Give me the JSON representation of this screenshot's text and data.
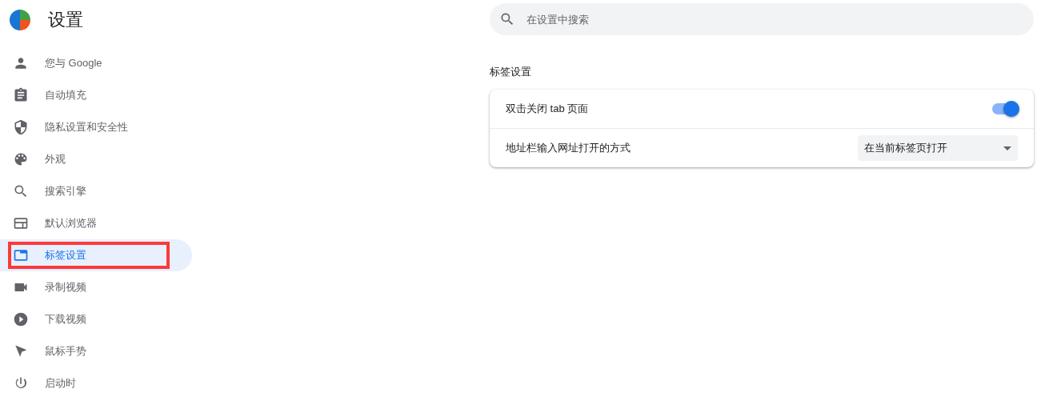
{
  "header": {
    "title": "设置"
  },
  "sidebar": {
    "items": [
      {
        "label": "您与 Google",
        "selected": false
      },
      {
        "label": "自动填充",
        "selected": false
      },
      {
        "label": "隐私设置和安全性",
        "selected": false
      },
      {
        "label": "外观",
        "selected": false
      },
      {
        "label": "搜索引擎",
        "selected": false
      },
      {
        "label": "默认浏览器",
        "selected": false
      },
      {
        "label": "标签设置",
        "selected": true,
        "annotated": true
      },
      {
        "label": "录制视频",
        "selected": false
      },
      {
        "label": "下载视频",
        "selected": false
      },
      {
        "label": "鼠标手势",
        "selected": false
      },
      {
        "label": "启动时",
        "selected": false
      }
    ]
  },
  "search": {
    "placeholder": "在设置中搜索"
  },
  "section": {
    "title": "标签设置",
    "rows": [
      {
        "kind": "toggle",
        "label": "双击关闭 tab 页面",
        "on": true
      },
      {
        "kind": "select",
        "label": "地址栏输入网址打开的方式",
        "value": "在当前标签页打开"
      }
    ]
  }
}
